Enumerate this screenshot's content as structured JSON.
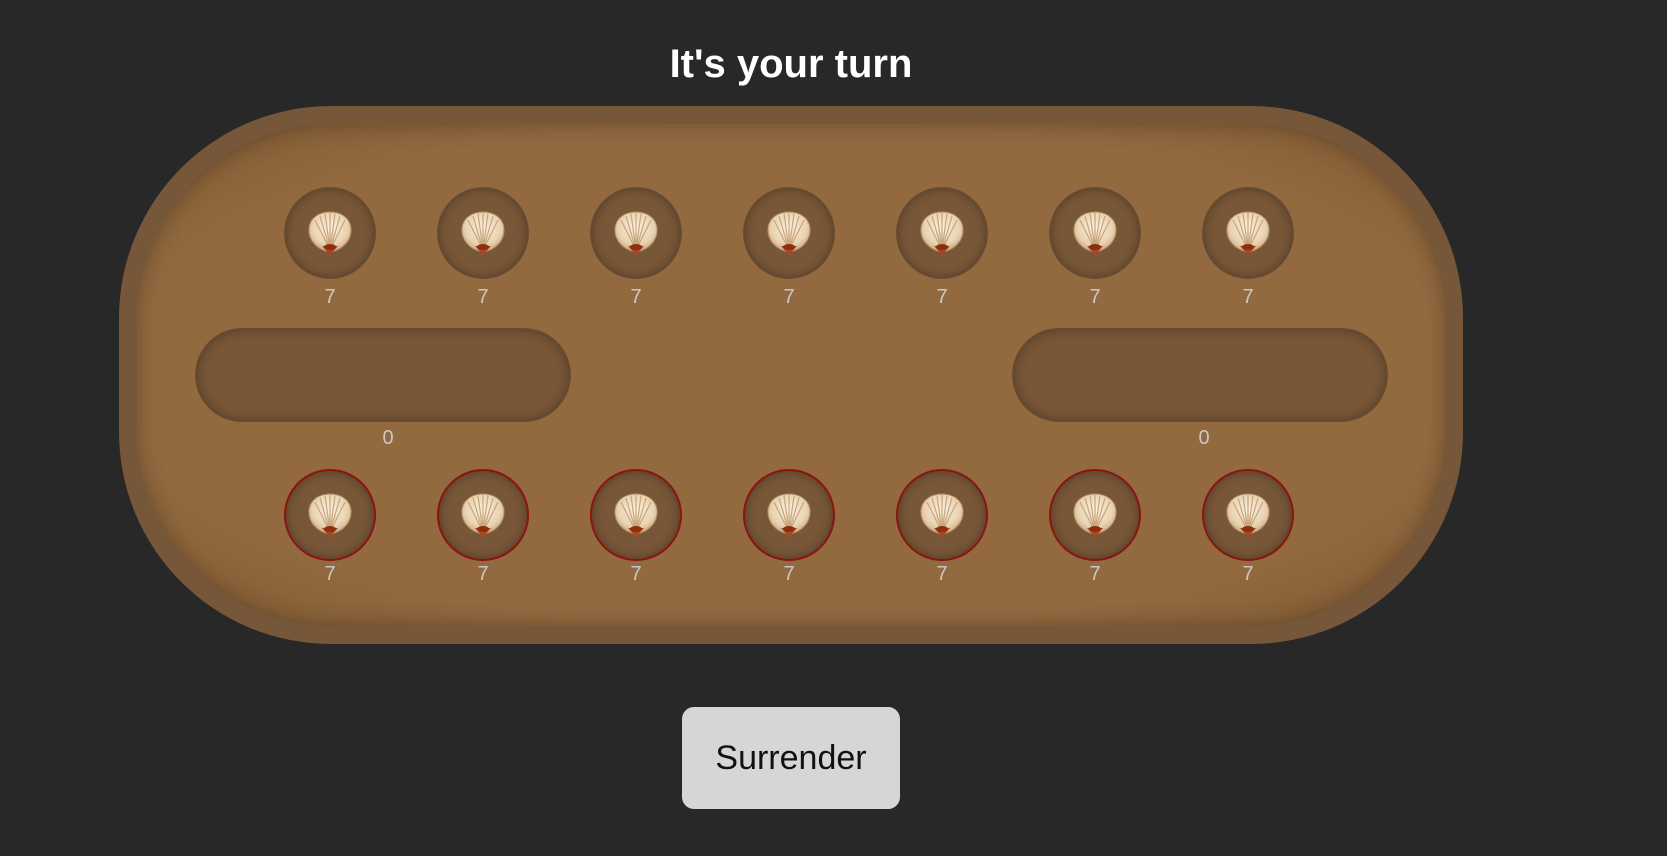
{
  "title": "It's your turn",
  "colors": {
    "background": "#282828",
    "board": "#936a40",
    "pit": "#785738",
    "player_pit_border": "#8a1410"
  },
  "icon": "scallop-shell-icon",
  "top_row": [
    {
      "count": "7"
    },
    {
      "count": "7"
    },
    {
      "count": "7"
    },
    {
      "count": "7"
    },
    {
      "count": "7"
    },
    {
      "count": "7"
    },
    {
      "count": "7"
    }
  ],
  "bottom_row": [
    {
      "count": "7"
    },
    {
      "count": "7"
    },
    {
      "count": "7"
    },
    {
      "count": "7"
    },
    {
      "count": "7"
    },
    {
      "count": "7"
    },
    {
      "count": "7"
    }
  ],
  "stores": {
    "left": {
      "count": "0"
    },
    "right": {
      "count": "0"
    }
  },
  "surrender_label": "Surrender"
}
